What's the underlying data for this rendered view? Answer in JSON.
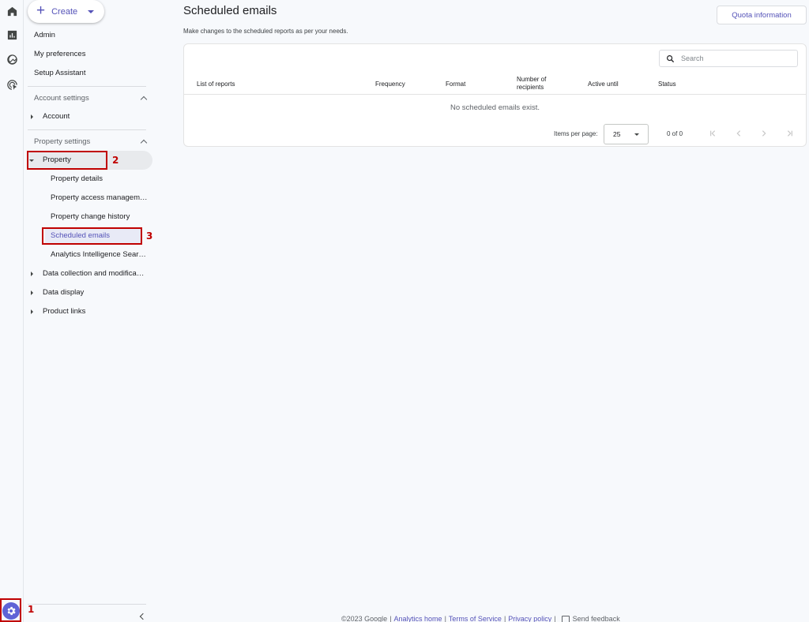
{
  "rail": {
    "icons": [
      "home-icon",
      "reports-icon",
      "explore-icon",
      "advertising-icon"
    ],
    "admin_icon": "gear-icon",
    "step": "1"
  },
  "sidebar": {
    "create_label": "Create",
    "top_items": [
      "Admin",
      "My preferences",
      "Setup Assistant"
    ],
    "account_settings": {
      "header": "Account settings",
      "items": [
        "Account"
      ]
    },
    "property_settings": {
      "header": "Property settings",
      "property": {
        "label": "Property",
        "step": "2",
        "children": [
          "Property details",
          "Property access managem…",
          "Property change history",
          "Scheduled emails",
          "Analytics Intelligence Sear…"
        ],
        "selected_step": "3"
      },
      "items": [
        "Data collection and modifica…",
        "Data display",
        "Product links"
      ]
    }
  },
  "main": {
    "title": "Scheduled emails",
    "subtitle": "Make changes to the scheduled reports as per your needs.",
    "quota_button": "Quota information",
    "search_placeholder": "Search",
    "columns": [
      "List of reports",
      "Frequency",
      "Format",
      "Number of recipients",
      "Active until",
      "Status"
    ],
    "columns_split": {
      "recipients_line1": "Number of",
      "recipients_line2": "recipients"
    },
    "empty_message": "No scheduled emails exist.",
    "pagination": {
      "items_per_page_label": "Items per page:",
      "items_per_page_value": "25",
      "range": "0 of 0"
    }
  },
  "footer": {
    "copyright": "©2023 Google",
    "links": [
      "Analytics home",
      "Terms of Service",
      "Privacy policy"
    ],
    "feedback": "Send feedback"
  },
  "colors": {
    "accent": "#5452b8",
    "highlight_box": "#c00000",
    "admin_icon_bg": "#5f63d6"
  }
}
